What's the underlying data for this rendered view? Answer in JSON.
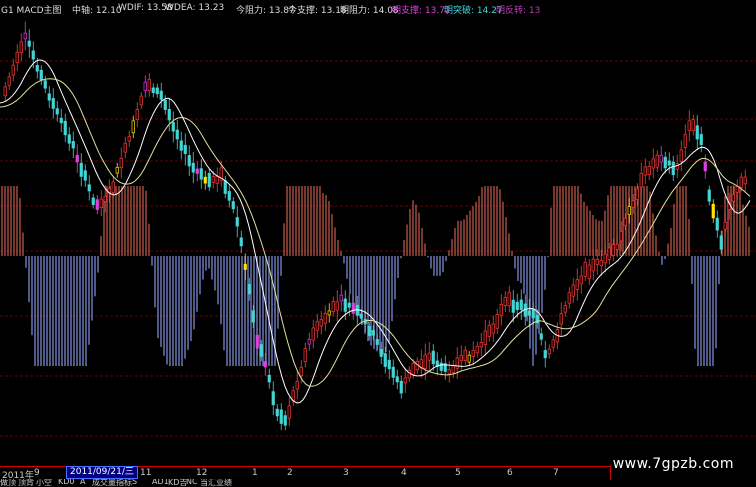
{
  "header": {
    "indicator": "G1 MACD主图",
    "mid": "中轴: 12.10",
    "wdif": "WDIF: 13.58",
    "wdea": "WDEA: 13.23",
    "today_resist": "今阻力: 13.87",
    "today_support": "今支撑: 13.18",
    "tomorrow_resist": "明阻力: 14.08",
    "tomorrow_support": "明支撑: 13.72",
    "tomorrow_breakout": "明突破: 14.27",
    "tomorrow_reversal": "明反转: 13"
  },
  "colors": {
    "up": "#ff3c3c",
    "down": "#44d4d4",
    "ma_fast": "#ffffff",
    "ma_slow": "#e0e0a0",
    "hist_pos": "#c05a4a",
    "hist_neg": "#7f8fd8",
    "magenta": "#e040e0",
    "yellow": "#ffe400",
    "grid": "#6b0000"
  },
  "axis": {
    "labels": [
      "2011年",
      "9",
      "11",
      "12",
      "1",
      "2",
      "3",
      "4",
      "5",
      "6",
      "7"
    ],
    "selected_date": "2011/09/21/三"
  },
  "status": {
    "items": [
      "做顶",
      "顶背",
      "小空",
      "KD0",
      "A",
      "成交量指标",
      "S",
      "AD1",
      "KD吉",
      "NC",
      "当汇业绩"
    ]
  },
  "watermark": "www.7gpzb.com"
}
